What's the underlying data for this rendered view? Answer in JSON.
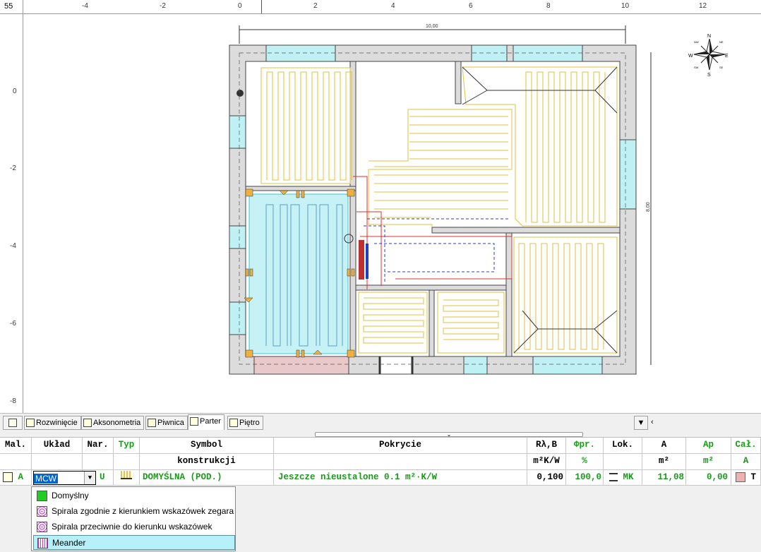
{
  "ruler": {
    "corner": "55",
    "h_ticks": [
      "-4",
      "-2",
      "0",
      "2",
      "4",
      "6",
      "8",
      "10",
      "12"
    ],
    "v_ticks": [
      "0",
      "-2",
      "-4",
      "-6",
      "-8"
    ]
  },
  "drawing": {
    "dim_width": "10,00",
    "dim_height": "8,00",
    "compass": {
      "n": "N",
      "s": "S",
      "e": "E",
      "w": "W",
      "ne": "NE",
      "nw": "NW",
      "se": "SE",
      "sw": "SW"
    }
  },
  "tabs": [
    "Rozwinięcie",
    "Aksonometria",
    "Piwnica",
    "Parter",
    "Piętro"
  ],
  "active_tab": "Parter",
  "table": {
    "headers": {
      "mal": "Mal.",
      "uklad": "Układ",
      "nar": "Nar.",
      "typ": "Typ",
      "symbol": "Symbol",
      "symbol2": "konstrukcji",
      "pokrycie": "Pokrycie",
      "r": "Rλ,B",
      "r_unit": "m²K/W",
      "phi": "Φpr.",
      "phi_unit": "%",
      "lok": "Lok.",
      "a": "A",
      "a_unit": "m²",
      "ap": "Ap",
      "ap_unit": "m²",
      "cal": "Cał.",
      "cal_unit": "A"
    },
    "row": {
      "mal": "A",
      "uklad": "MCW",
      "nar": "U",
      "symbol": "DOMYŚLNA (POD.)",
      "pokrycie": "Jeszcze nieustalone 0.1 m²·K/W",
      "r": "0,100",
      "phi": "100,0",
      "lok": "MK",
      "a": "11,08",
      "ap": "0,00",
      "cal": "T"
    }
  },
  "dropdown": {
    "items": [
      {
        "label": "Domyślny",
        "icon": "green-square-icon"
      },
      {
        "label": "Spirala zgodnie z kierunkiem wskazówek zegara",
        "icon": "spiral-cw-icon"
      },
      {
        "label": "Spirala przeciwnie do kierunku wskazówek zegara",
        "icon": "spiral-ccw-icon"
      },
      {
        "label": "Meander",
        "icon": "meander-icon"
      }
    ],
    "selected": "Meander"
  },
  "colors": {
    "accent_green": "#1a9a1a",
    "pipe": "#e6c84a",
    "selection": "#b6f0f8",
    "room_blue": "#bff0f4"
  }
}
